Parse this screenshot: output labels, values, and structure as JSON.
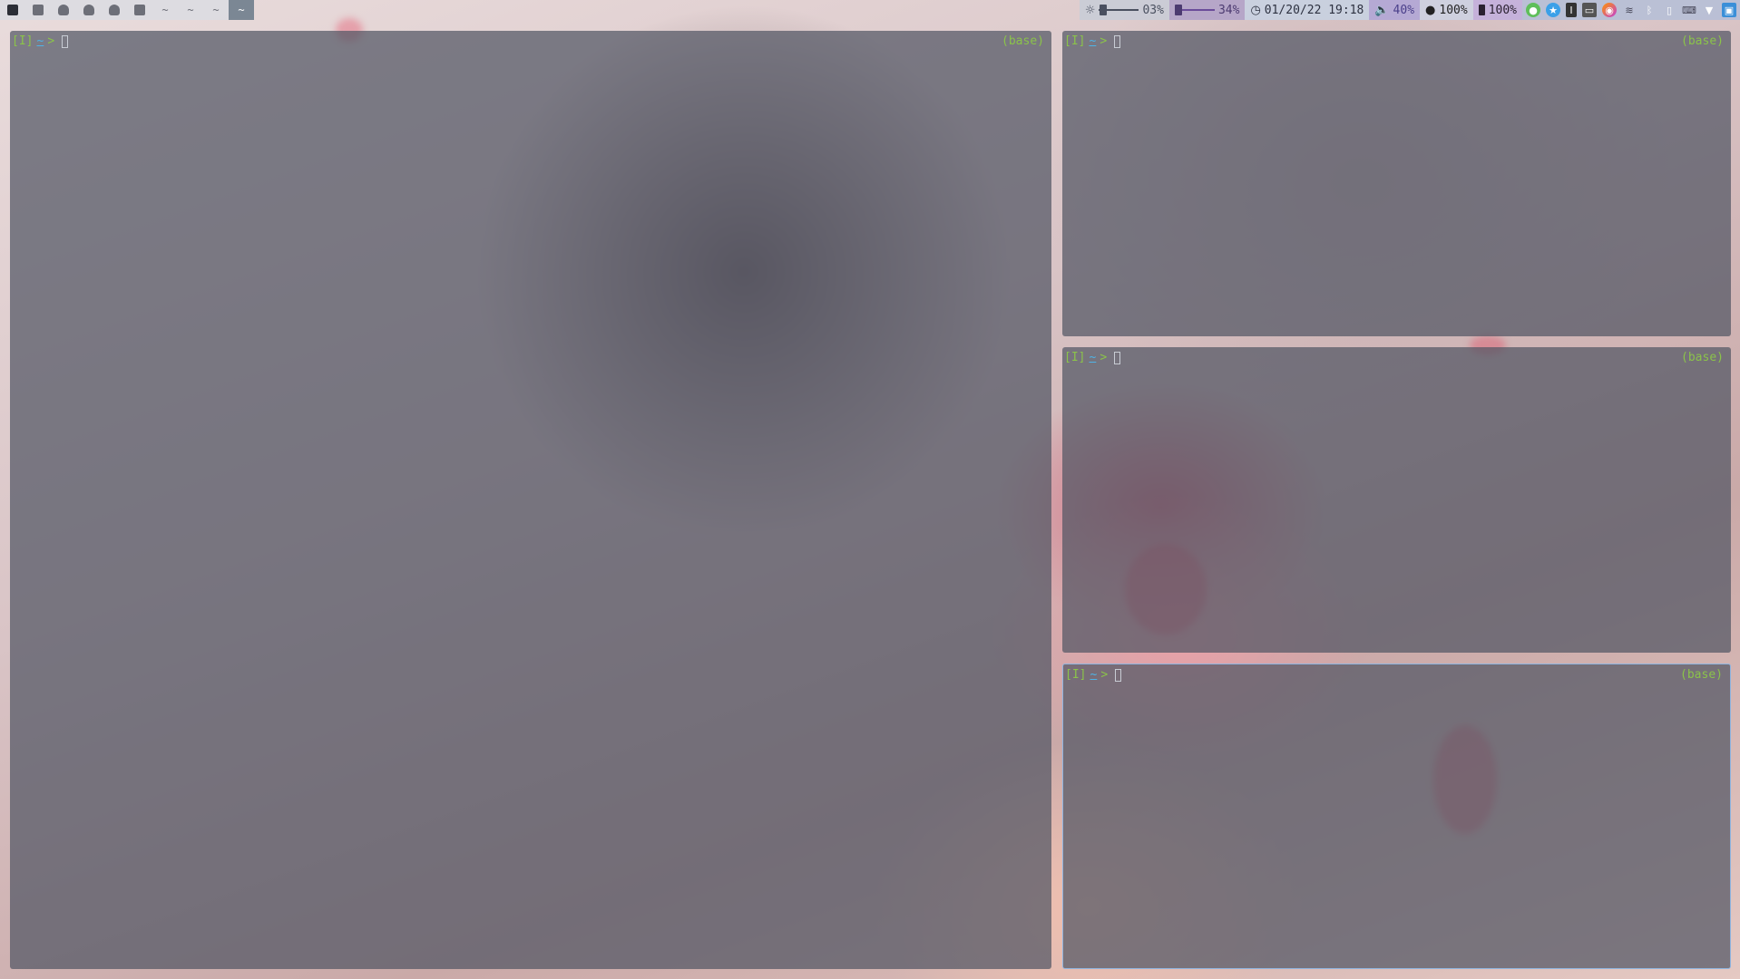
{
  "workspaces": [
    {
      "icon": "terminal-icon",
      "label": ""
    },
    {
      "icon": "music-icon",
      "label": ""
    },
    {
      "icon": "qq-icon",
      "label": ""
    },
    {
      "icon": "wechat-icon",
      "label": ""
    },
    {
      "icon": "ghost-icon",
      "label": ""
    },
    {
      "icon": "layout-icon",
      "label": ""
    },
    {
      "icon": "",
      "label": "~"
    },
    {
      "icon": "",
      "label": "~"
    },
    {
      "icon": "",
      "label": "~"
    },
    {
      "icon": "",
      "label": "~",
      "active": true
    }
  ],
  "status": {
    "brightness": "03%",
    "memory": "34%",
    "datetime": "01/20/22 19:18",
    "volume": "40%",
    "cpu": "100%",
    "battery": "100%"
  },
  "tray_icons": [
    "wechat-tray-icon",
    "star-tray-icon",
    "ime-tray-icon",
    "printer-tray-icon",
    "firefox-tray-icon",
    "wifi-tray-icon",
    "bluetooth-tray-icon",
    "usb-tray-icon",
    "keyboard-tray-icon",
    "network-tray-icon",
    "display-tray-icon"
  ],
  "terminals": [
    {
      "mode": "[I]",
      "dir": "~",
      "arrow": ">",
      "env": "(base)"
    },
    {
      "mode": "[I]",
      "dir": "~",
      "arrow": ">",
      "env": "(base)"
    },
    {
      "mode": "[I]",
      "dir": "~",
      "arrow": ">",
      "env": "(base)"
    },
    {
      "mode": "[I]",
      "dir": "~",
      "arrow": ">",
      "env": "(base)"
    }
  ],
  "colors": {
    "prompt_green": "#8bc34a",
    "tilde_blue": "#4fb3e6",
    "focus_border": "#8fb5e0"
  }
}
